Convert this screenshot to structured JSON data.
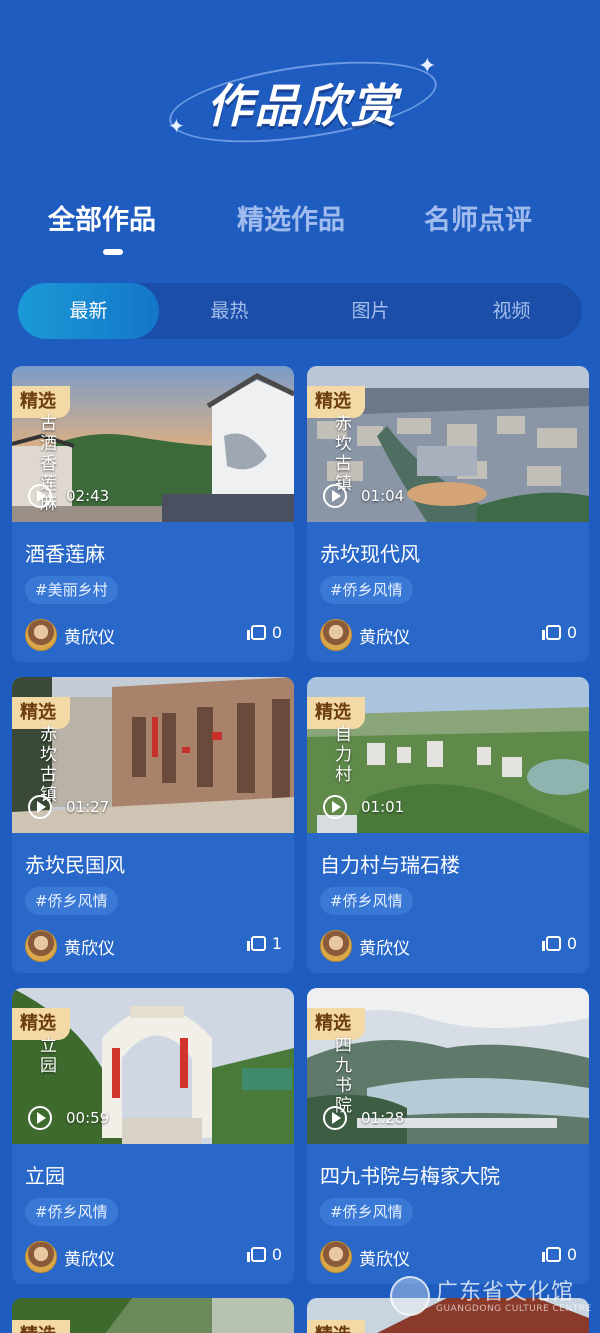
{
  "header": {
    "title": "作品欣赏",
    "sparkle_icon": "sparkle-icon"
  },
  "tabs": [
    {
      "label": "全部作品",
      "active": true
    },
    {
      "label": "精选作品",
      "active": false
    },
    {
      "label": "名师点评",
      "active": false
    }
  ],
  "filters": [
    {
      "label": "最新",
      "active": true
    },
    {
      "label": "最热",
      "active": false
    },
    {
      "label": "图片",
      "active": false
    },
    {
      "label": "视频",
      "active": false
    }
  ],
  "cards": [
    {
      "badge": "精选",
      "overlay": "古酒香莲麻",
      "duration": "02:43",
      "title": "酒香莲麻",
      "tag": "#美丽乡村",
      "author": "黄欣仪",
      "likes": "0"
    },
    {
      "badge": "精选",
      "overlay": "赤坎古镇",
      "duration": "01:04",
      "title": "赤坎现代风",
      "tag": "#侨乡风情",
      "author": "黄欣仪",
      "likes": "0"
    },
    {
      "badge": "精选",
      "overlay": "赤坎古镇",
      "duration": "01:27",
      "title": "赤坎民国风",
      "tag": "#侨乡风情",
      "author": "黄欣仪",
      "likes": "1"
    },
    {
      "badge": "精选",
      "overlay": "自力村",
      "duration": "01:01",
      "title": "自力村与瑞石楼",
      "tag": "#侨乡风情",
      "author": "黄欣仪",
      "likes": "0"
    },
    {
      "badge": "精选",
      "overlay": "立园",
      "duration": "00:59",
      "title": "立园",
      "tag": "#侨乡风情",
      "author": "黄欣仪",
      "likes": "0"
    },
    {
      "badge": "精选",
      "overlay": "四九书院",
      "duration": "01:28",
      "title": "四九书院与梅家大院",
      "tag": "#侨乡风情",
      "author": "黄欣仪",
      "likes": "0"
    }
  ],
  "peek": {
    "badge": "精选"
  },
  "watermark": {
    "cn": "广东省文化馆",
    "en": "GUANGDONG CULTURE CENTRE"
  },
  "colors": {
    "background": "#1f5cc0",
    "card": "#2968c8",
    "badge": "#f3d9a6",
    "active_filter": "#1b9ad6"
  },
  "icons": {
    "play": "play-icon",
    "like": "thumbs-up-icon",
    "avatar": "avatar"
  }
}
